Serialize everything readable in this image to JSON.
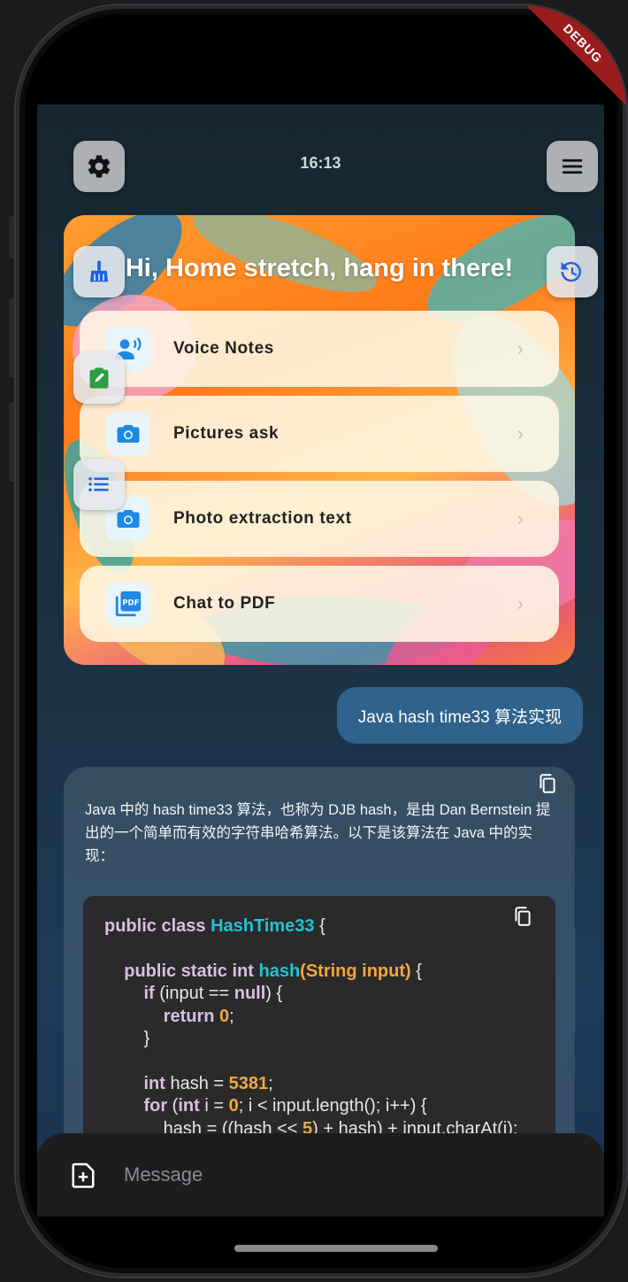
{
  "status": {
    "time": "16:13",
    "debug": "DEBUG"
  },
  "header": {
    "settings_icon": "gear-icon",
    "menu_icon": "hamburger-icon"
  },
  "banner": {
    "greeting": "Hi, Home stretch, hang in there!",
    "features": [
      {
        "label": "Voice Notes",
        "icon": "voice-icon"
      },
      {
        "label": "Pictures ask",
        "icon": "camera-icon"
      },
      {
        "label": "Photo extraction text",
        "icon": "camera-icon"
      },
      {
        "label": "Chat to PDF",
        "icon": "pdf-icon"
      }
    ]
  },
  "chat": {
    "user_message": "Java hash time33 算法实现",
    "ai_intro": "Java 中的 hash time33 算法，也称为 DJB hash，是由 Dan Bernstein 提出的一个简单而有效的字符串哈希算法。以下是该算法在 Java 中的实现：",
    "code": [
      "public class HashTime33 {",
      "",
      "    public static int hash(String input) {",
      "        if (input == null) {",
      "            return 0;",
      "        }",
      "",
      "        int hash = 5381;",
      "        for (int i = 0; i < input.length(); i++) {",
      "            hash = ((hash << 5) + hash) + input.charAt(i);"
    ]
  },
  "composer": {
    "placeholder": "Message"
  },
  "colors": {
    "user_bubble": "#2f628c",
    "code_bg": "#2a2a2b",
    "accent_cyan": "#22c3cf",
    "accent_orange": "#f4a73c"
  }
}
